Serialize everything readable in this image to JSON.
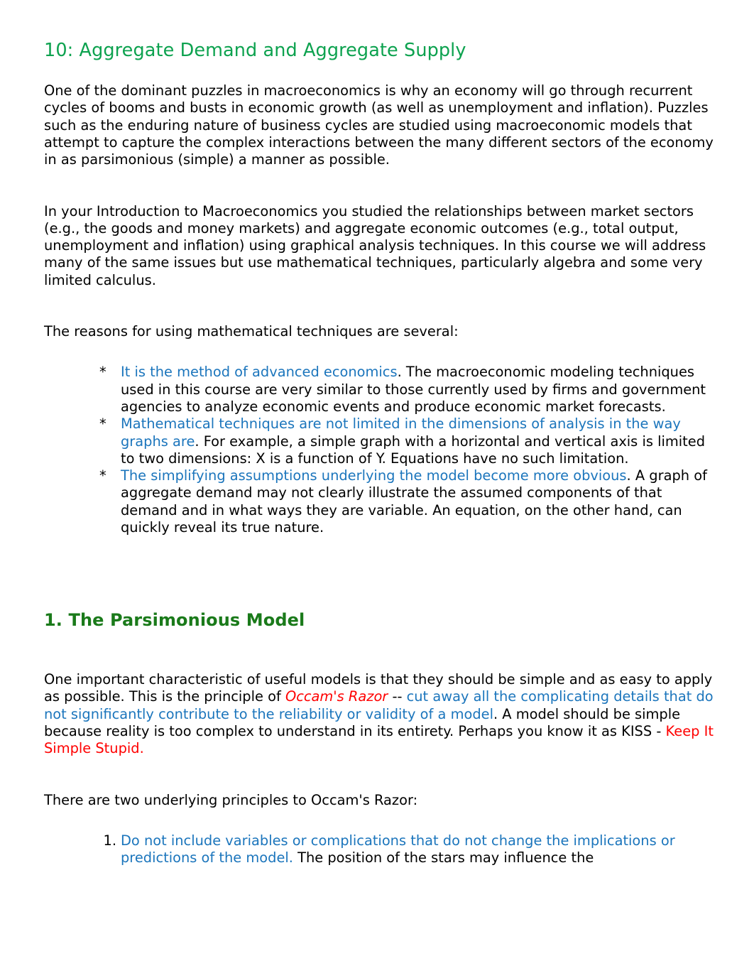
{
  "document": {
    "title": "10: Aggregate Demand and Aggregate Supply",
    "intro_paragraph_1": "One of the dominant puzzles in macroeconomics is why an economy will go through recurrent cycles of booms and busts in economic growth (as well as unemployment and inflation). Puzzles such as the enduring nature of business cycles are studied using macroeconomic models that attempt to capture the complex interactions between the many different sectors of the economy in as parsimonious (simple) a manner as possible.",
    "intro_paragraph_2": "In your Introduction to Macroeconomics you studied the relationships between market sectors (e.g., the goods and money markets) and aggregate economic outcomes (e.g., total output, unemployment and inflation) using graphical analysis techniques. In this course we will address many of the same issues but use mathematical techniques, particularly algebra and some very limited calculus.",
    "reasons_lead_in": "The reasons for using mathematical techniques are several:",
    "reasons_list": [
      {
        "marker": "*",
        "highlight": "It is the method of advanced economics",
        "rest": ". The macroeconomic modeling techniques used in this course are very similar to those currently used by firms and government agencies to analyze economic events and produce economic market forecasts."
      },
      {
        "marker": "*",
        "highlight": "Mathematical techniques are not limited in the dimensions of analysis in the way graphs are",
        "rest": ". For example, a simple graph with a horizontal and vertical axis is limited to two dimensions: X is a function of Y. Equations have no such limitation."
      },
      {
        "marker": "*",
        "highlight": "The simplifying assumptions underlying the model become more obvious",
        "rest": ". A graph of aggregate demand may not clearly illustrate the assumed components of that demand and in what ways they are variable. An equation, on the other hand, can quickly reveal its true nature."
      }
    ],
    "section_1": {
      "heading": "1. The Parsimonious Model",
      "paragraph_lead": "One important characteristic of useful models is that they should be simple and as easy to apply as possible. This is the principle of ",
      "occams_razor": "Occam's Razor",
      "paragraph_dash": " -- ",
      "razor_definition": "cut away all the complicating details that do not significantly contribute to the reliability or validity of a model",
      "paragraph_mid": ". A model should be simple because reality is too complex to understand in its entirety. Perhaps you know it as KISS - ",
      "kiss_phrase": "Keep It Simple Stupid.",
      "principles_lead_in": "There are two underlying principles to Occam's Razor:",
      "principles_list": [
        {
          "marker": "1.",
          "highlight": "Do not include variables or complications that do not change the implications or predictions of the model.",
          "rest": " The position of the stars may influence the"
        }
      ]
    },
    "colors": {
      "title_green": "#0DA24F",
      "heading_green": "#1A7A1A",
      "link_blue": "#1B75BC",
      "accent_red": "#FF0000",
      "body_black": "#000000",
      "page_background": "#FFFFFF"
    }
  }
}
